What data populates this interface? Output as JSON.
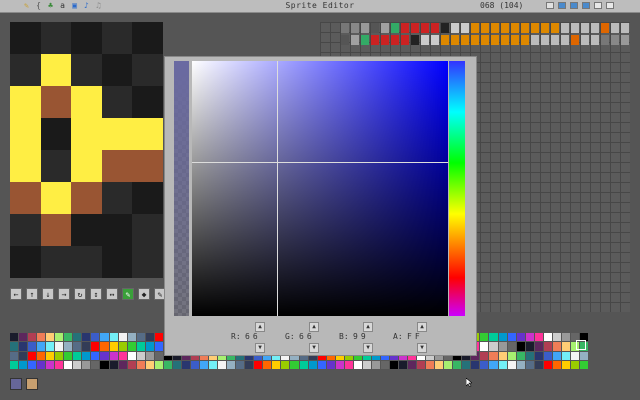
{
  "window": {
    "title": "Sprite Editor",
    "sprite_index": "068 (104)"
  },
  "toolbar_left": [
    "pencil-icon",
    "code-icon",
    "tree-icon",
    "text-a-icon",
    "map-icon",
    "music-icon",
    "sound-icon"
  ],
  "toolbar_right": [
    "cart-icon",
    "undo-icon",
    "redo-icon",
    "save-icon",
    "copy-icon",
    "paste-icon"
  ],
  "sprite": {
    "pixels": [
      [
        "#1a1a1a",
        "#2a2a2a",
        "#1a1a1a",
        "#2a2a2a",
        "#1a1a1a"
      ],
      [
        "#2a2a2a",
        "#ffee44",
        "#2a2a2a",
        "#1a1a1a",
        "#2a2a2a"
      ],
      [
        "#ffee44",
        "#995533",
        "#ffee44",
        "#2a2a2a",
        "#1a1a1a"
      ],
      [
        "#ffee44",
        "#1a1a1a",
        "#ffee44",
        "#ffee44",
        "#ffee44"
      ],
      [
        "#ffee44",
        "#2a2a2a",
        "#ffee44",
        "#995533",
        "#995533"
      ],
      [
        "#995533",
        "#ffee44",
        "#995533",
        "#2a2a2a",
        "#1a1a1a"
      ],
      [
        "#2a2a2a",
        "#995533",
        "#1a1a1a",
        "#1a1a1a",
        "#2a2a2a"
      ],
      [
        "#1a1a1a",
        "#2a2a2a",
        "#2a2a2a",
        "#1a1a1a",
        "#2a2a2a"
      ]
    ]
  },
  "tools": [
    {
      "name": "shift-left-icon",
      "glyph": "←"
    },
    {
      "name": "shift-up-icon",
      "glyph": "↑"
    },
    {
      "name": "shift-down-icon",
      "glyph": "↓"
    },
    {
      "name": "shift-right-icon",
      "glyph": "→"
    },
    {
      "name": "rotate-icon",
      "glyph": "↻"
    },
    {
      "name": "flip-vertical-icon",
      "glyph": "↕"
    },
    {
      "name": "flip-horizontal-icon",
      "glyph": "↔"
    },
    {
      "name": "pencil-tool-icon",
      "glyph": "✎",
      "active": true
    },
    {
      "name": "fill-tool-icon",
      "glyph": "◆"
    },
    {
      "name": "select-tool-icon",
      "glyph": "✎"
    }
  ],
  "color_picker": {
    "r_label": "R:",
    "r_value": "66",
    "g_label": "G:",
    "g_value": "66",
    "b_label": "B:",
    "b_value": "99",
    "a_label": "A:",
    "a_value": "FF",
    "selected_color": "#666699"
  },
  "palette_colors": [
    "#1a1c2c",
    "#5d275d",
    "#b13e53",
    "#ef7d57",
    "#ffcd75",
    "#a7f070",
    "#38b764",
    "#257179",
    "#29366f",
    "#3b5dc9",
    "#41a6f6",
    "#73eff7",
    "#f4f4f4",
    "#94b0c2",
    "#566c86",
    "#333c57",
    "#ff0000",
    "#ff6600",
    "#ffcc00",
    "#99cc00",
    "#33cc33",
    "#00cc99",
    "#0099cc",
    "#3366ff",
    "#6633cc",
    "#cc33cc",
    "#ff3399",
    "#ffffff",
    "#cccccc",
    "#999999",
    "#666666",
    "#000000"
  ],
  "accent": "#3aa03a"
}
